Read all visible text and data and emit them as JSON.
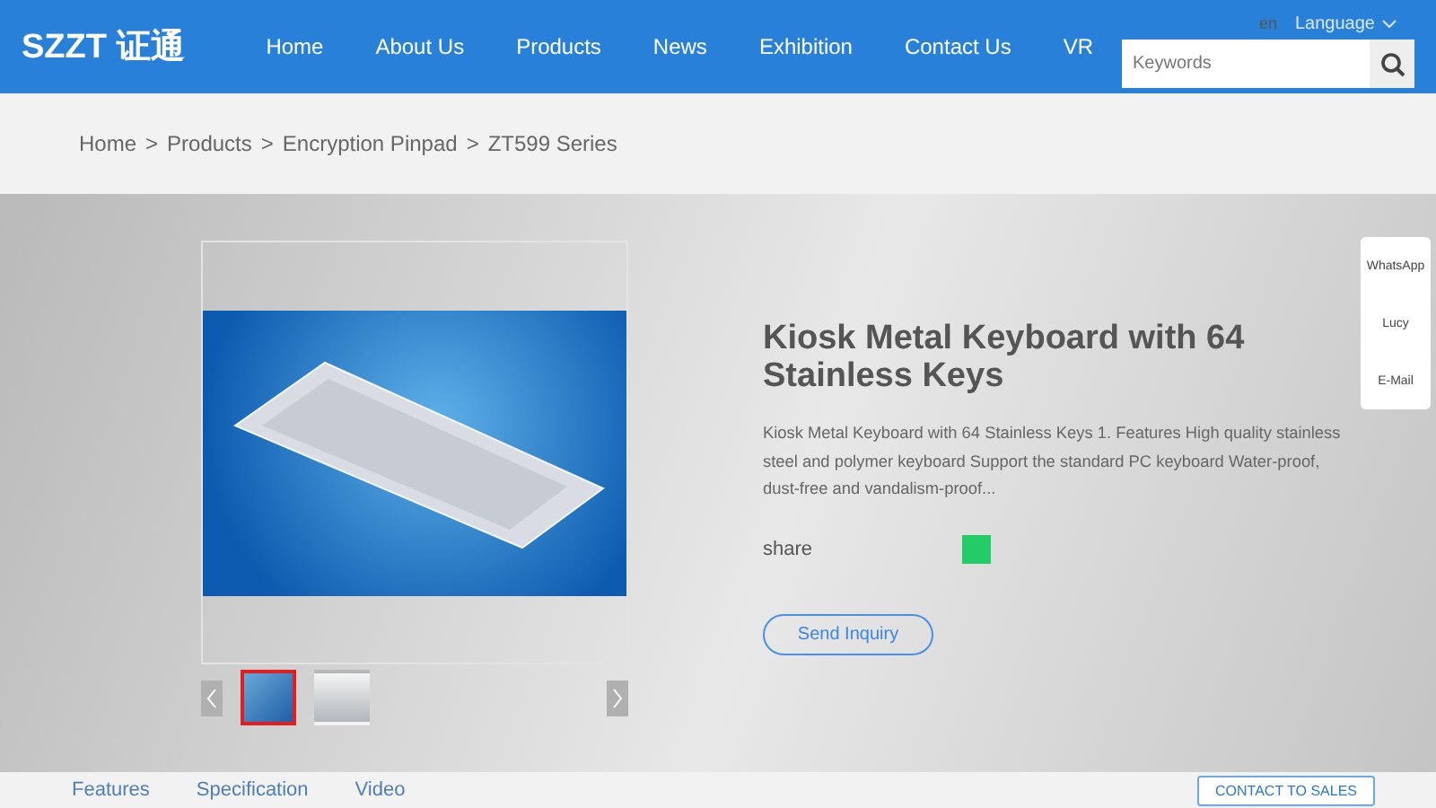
{
  "header": {
    "logo": "SZZT 证通",
    "nav": [
      "Home",
      "About Us",
      "Products",
      "News",
      "Exhibition",
      "Contact Us",
      "VR"
    ],
    "lang_code": "en",
    "language": "Language",
    "search": {
      "placeholder": "Keywords"
    }
  },
  "breadcrumb": [
    "Home",
    "Products",
    "Encryption Pinpad",
    "ZT599 Series"
  ],
  "breadcrumb_separator": ">",
  "product": {
    "title": "Kiosk Metal Keyboard with 64 Stainless Keys",
    "description": "Kiosk Metal Keyboard with 64 Stainless Keys 1. Features High quality stainless steel and polymer keyboard Support the standard PC keyboard Water-proof, dust-free and vandalism-proof...",
    "share": "share",
    "inquiry": "Send Inquiry",
    "thumbnails": [
      {
        "selected": true
      },
      {
        "selected": false
      }
    ]
  },
  "side_contacts": [
    "WhatsApp",
    "Lucy",
    "E-Mail"
  ],
  "tabs": [
    "Features",
    "Specification",
    "Video"
  ],
  "contact_button": "CONTACT TO SALES"
}
